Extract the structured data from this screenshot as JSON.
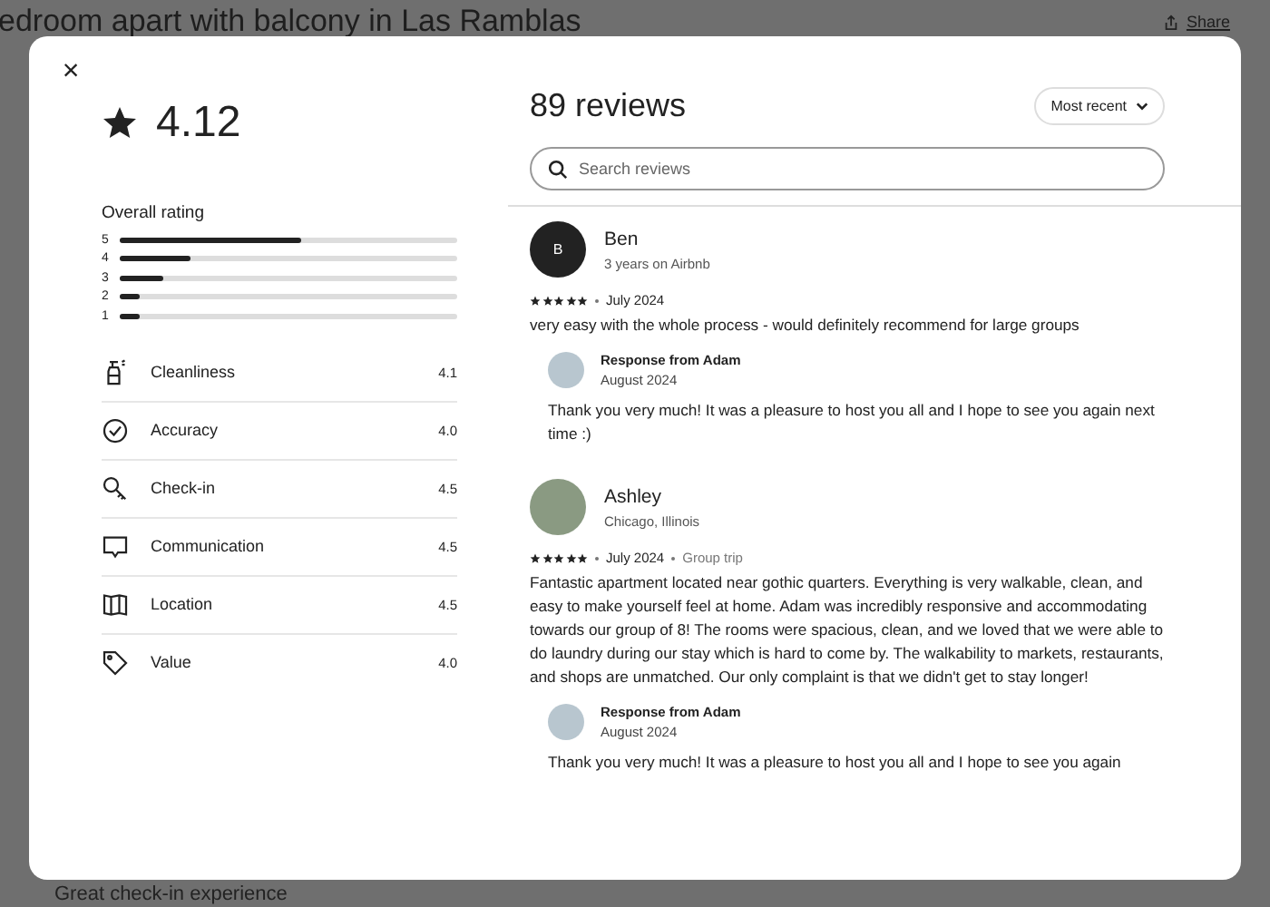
{
  "page": {
    "title": "edroom apart with balcony in Las Ramblas",
    "share": "Share",
    "highlight": "Great check-in experience"
  },
  "modal": {
    "close": "×",
    "summary": {
      "score": "4.12",
      "overall_label": "Overall rating",
      "distribution": [
        {
          "label": "5",
          "level": 0.54
        },
        {
          "label": "4",
          "level": 0.21
        },
        {
          "label": "3",
          "level": 0.13
        },
        {
          "label": "2",
          "level": 0.06
        },
        {
          "label": "1",
          "level": 0.06
        }
      ],
      "categories": [
        {
          "kind": "cleanliness",
          "label": "Cleanliness",
          "score": "4.1"
        },
        {
          "kind": "accuracy",
          "label": "Accuracy",
          "score": "4.0"
        },
        {
          "kind": "checkin",
          "label": "Check-in",
          "score": "4.5"
        },
        {
          "kind": "communication",
          "label": "Communication",
          "score": "4.5"
        },
        {
          "kind": "location",
          "label": "Location",
          "score": "4.5"
        },
        {
          "kind": "value",
          "label": "Value",
          "score": "4.0"
        }
      ]
    },
    "reviews_title": "89 reviews",
    "sort": "Most recent",
    "search": {
      "placeholder": "Search reviews"
    },
    "reviews": [
      {
        "name": "Ben",
        "avatar": {
          "kind": "initial",
          "text": "B"
        },
        "subtitle": "3 years on Airbnb",
        "stars": 5,
        "date": "July 2024",
        "text": "very easy with the whole process - would definitely recommend for large groups",
        "response": {
          "title": "Response from Adam",
          "date": "August 2024",
          "text": "Thank you very much! It was a pleasure to host you all and I hope to see you again next time :)"
        }
      },
      {
        "name": "Ashley",
        "avatar": {
          "kind": "photo"
        },
        "subtitle": "Chicago, Illinois",
        "stars": 5,
        "date": "July 2024",
        "trip": "Group trip",
        "text": "Fantastic apartment located near gothic quarters. Everything is very walkable, clean, and easy to make yourself feel at home. Adam was incredibly responsive and accommodating towards our group of 8! The rooms were spacious, clean, and we loved that we were able to do laundry during our stay which is hard to come by. The walkability to markets, restaurants, and shops are unmatched. Our only complaint is that we didn't get to stay longer!",
        "response": {
          "title": "Response from Adam",
          "date": "August 2024",
          "text": "Thank you very much! It was a pleasure to host you all and I hope to see you again"
        }
      }
    ]
  }
}
